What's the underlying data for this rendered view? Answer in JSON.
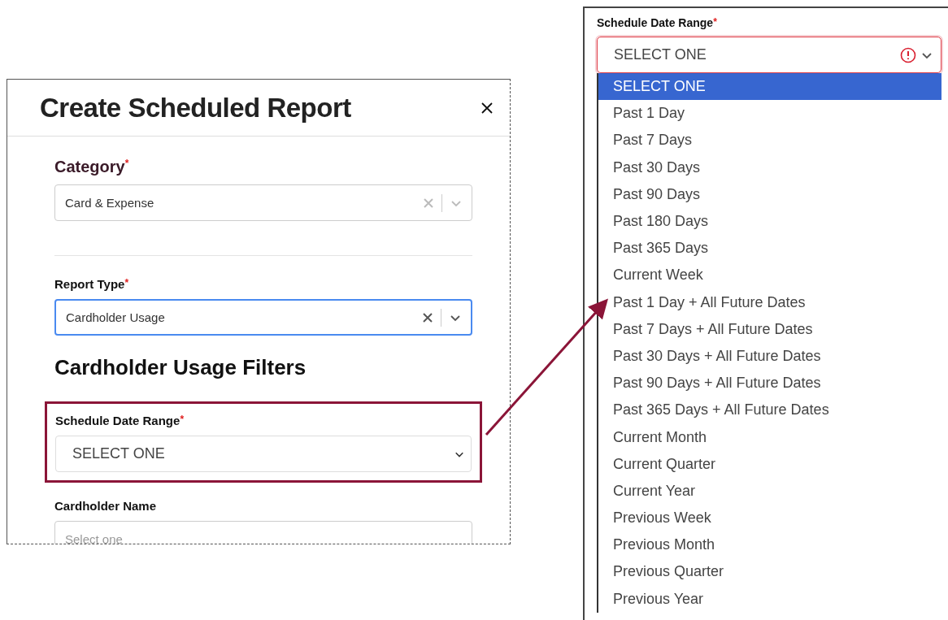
{
  "dialog": {
    "title": "Create Scheduled Report",
    "fields": [
      {
        "label": "Category",
        "required": "*",
        "value": "Card & Expense",
        "focused": false
      },
      {
        "label": "Report Type",
        "required": "*",
        "value": "Cardholder Usage",
        "focused": true
      }
    ],
    "section_title": "Cardholder Usage Filters",
    "date_range": {
      "label": "Schedule Date Range",
      "required": "*",
      "value": "SELECT ONE",
      "highlighted": true
    },
    "cardholder": {
      "label": "Cardholder Name",
      "placeholder": "Select one"
    }
  },
  "dropdown": {
    "label": "Schedule Date Range",
    "required": "*",
    "value": "SELECT ONE",
    "error": true,
    "options": [
      {
        "label": "SELECT ONE",
        "selected": true
      },
      {
        "label": "Past 1 Day",
        "selected": false
      },
      {
        "label": "Past 7 Days",
        "selected": false
      },
      {
        "label": "Past 30 Days",
        "selected": false
      },
      {
        "label": "Past 90 Days",
        "selected": false
      },
      {
        "label": "Past 180 Days",
        "selected": false
      },
      {
        "label": "Past 365 Days",
        "selected": false
      },
      {
        "label": "Current Week",
        "selected": false
      },
      {
        "label": "Past 1 Day + All Future Dates",
        "selected": false
      },
      {
        "label": "Past 7 Days + All Future Dates",
        "selected": false
      },
      {
        "label": "Past 30 Days + All Future Dates",
        "selected": false
      },
      {
        "label": "Past 90 Days + All Future Dates",
        "selected": false
      },
      {
        "label": "Past 365 Days + All Future Dates",
        "selected": false
      },
      {
        "label": "Current Month",
        "selected": false
      },
      {
        "label": "Current Quarter",
        "selected": false
      },
      {
        "label": "Current Year",
        "selected": false
      },
      {
        "label": "Previous Week",
        "selected": false
      },
      {
        "label": "Previous Month",
        "selected": false
      },
      {
        "label": "Previous Quarter",
        "selected": false
      },
      {
        "label": "Previous Year",
        "selected": false
      }
    ]
  }
}
